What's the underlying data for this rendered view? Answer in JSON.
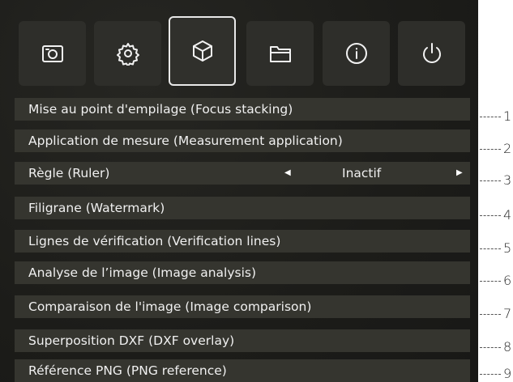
{
  "toolbar": {
    "buttons": [
      {
        "icon": "camera-icon",
        "active": false
      },
      {
        "icon": "gear-icon",
        "active": false
      },
      {
        "icon": "cube-icon",
        "active": true
      },
      {
        "icon": "folder-icon",
        "active": false
      },
      {
        "icon": "info-icon",
        "active": false
      },
      {
        "icon": "power-icon",
        "active": false
      }
    ]
  },
  "menu": {
    "items": [
      {
        "label": "Mise au point d'empilage (Focus stacking)",
        "callout": "1"
      },
      {
        "label": "Application de mesure (Measurement application)",
        "callout": "2"
      },
      {
        "label": "Règle (Ruler)",
        "value": "Inactif",
        "callout": "3"
      },
      {
        "label": "Filigrane (Watermark)",
        "callout": "4"
      },
      {
        "label": "Lignes de vérification (Verification lines)",
        "callout": "5"
      },
      {
        "label": "Analyse de l’image (Image analysis)",
        "callout": "6"
      },
      {
        "label": "Comparaison de l'image (Image comparison)",
        "callout": "7"
      },
      {
        "label": "Superposition DXF (DXF overlay)",
        "callout": "8"
      },
      {
        "label": "Référence PNG (PNG reference)",
        "callout": "9"
      }
    ]
  },
  "colors": {
    "background": "#1f1f1b",
    "row": "#35352f",
    "button": "#2e2e2a",
    "text": "#f0f0f0"
  }
}
